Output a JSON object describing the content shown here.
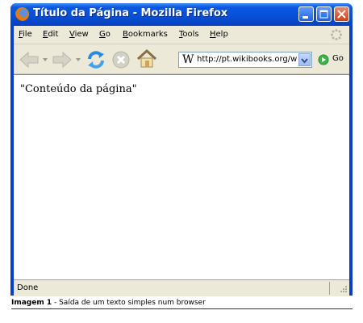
{
  "window": {
    "title": "Título da Página - Mozilla Firefox"
  },
  "menu": {
    "items": [
      {
        "accel": "F",
        "rest": "ile"
      },
      {
        "accel": "E",
        "rest": "dit"
      },
      {
        "accel": "V",
        "rest": "iew"
      },
      {
        "accel": "G",
        "rest": "o"
      },
      {
        "accel": "B",
        "rest": "ookmarks"
      },
      {
        "accel": "T",
        "rest": "ools"
      },
      {
        "accel": "H",
        "rest": "elp"
      }
    ]
  },
  "toolbar": {
    "back_icon": "back-arrow-icon",
    "forward_icon": "forward-arrow-icon",
    "reload_icon": "reload-icon",
    "stop_icon": "stop-icon",
    "home_icon": "home-icon"
  },
  "address": {
    "site_icon_glyph": "W",
    "url": "http://pt.wikibooks.org/w",
    "go_label": "Go"
  },
  "content": {
    "text": "\"Conteúdo da página\""
  },
  "status": {
    "text": "Done"
  },
  "caption": {
    "label": "Imagem 1",
    "text": " - Saída de um texto simples num browser"
  },
  "colors": {
    "titlebar": "#0a58e0",
    "chrome": "#ece9d8",
    "close_button": "#c9431c"
  }
}
